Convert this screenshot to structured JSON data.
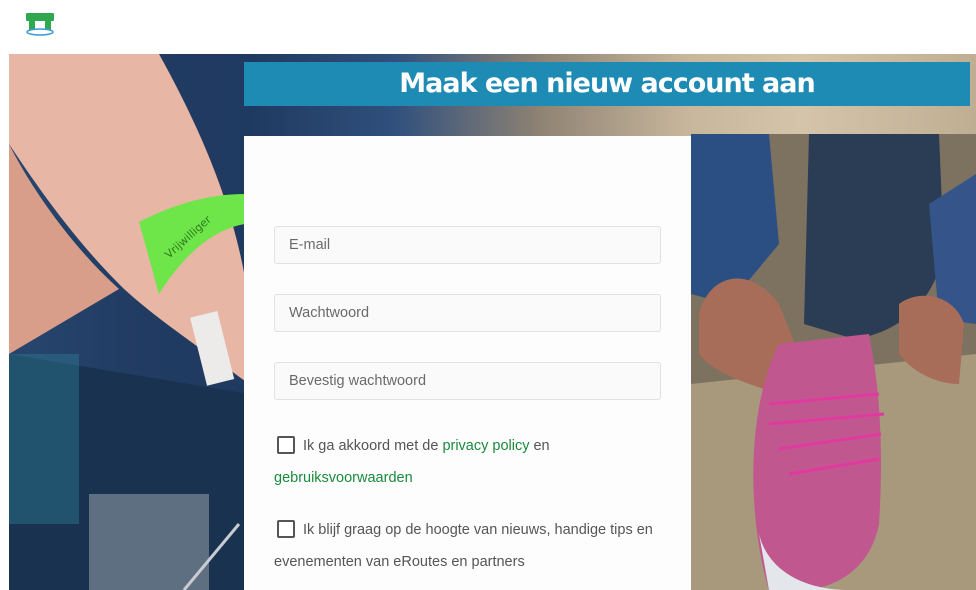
{
  "header": {
    "logo_icon": "green-table-logo-icon"
  },
  "banner": {
    "title": "Maak een nieuw account aan"
  },
  "form": {
    "email_placeholder": "E-mail",
    "password_placeholder": "Wachtwoord",
    "confirm_placeholder": "Bevestig wachtwoord",
    "terms": {
      "text_before": "Ik ga akkoord met de ",
      "privacy_link": "privacy policy",
      "text_middle": " en ",
      "terms_link": "gebruiksvoorwaarden"
    },
    "newsletter": {
      "text": "Ik blijf graag op de hoogte van nieuws, handige tips en evenementen van eRoutes en partners"
    }
  },
  "hero": {
    "wristband_text": "Vrijwilliger"
  },
  "colors": {
    "banner": "#1e8bb4",
    "link": "#1a8a3c",
    "logo": "#2fa84f"
  }
}
